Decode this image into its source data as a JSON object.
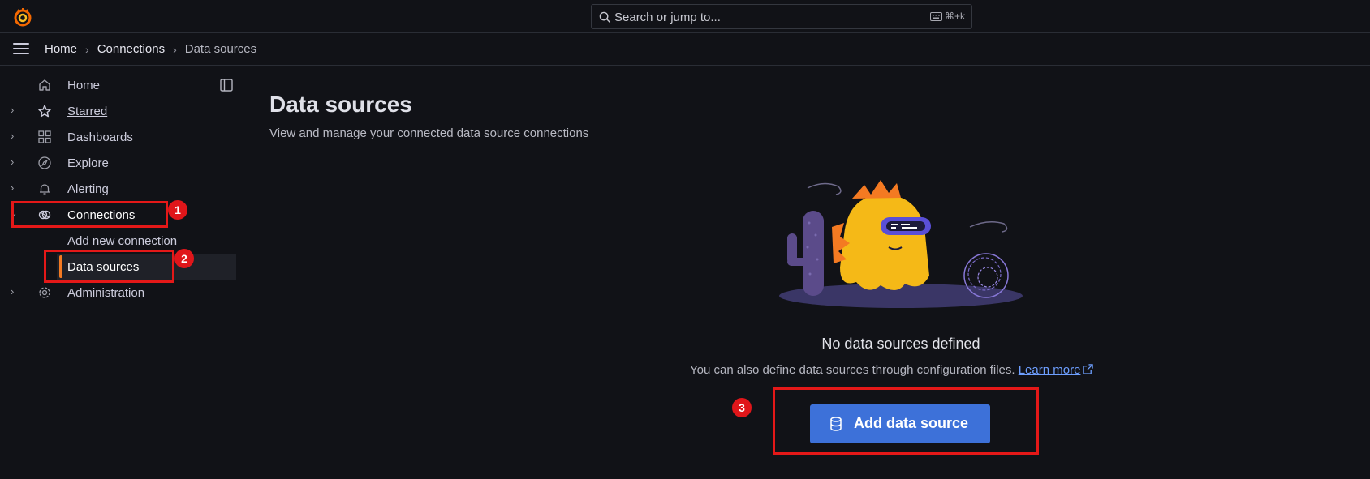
{
  "topbar": {
    "search_placeholder": "Search or jump to...",
    "shortcut": "⌘+k"
  },
  "breadcrumb": [
    "Home",
    "Connections",
    "Data sources"
  ],
  "sidebar": {
    "items": [
      {
        "label": "Home",
        "icon": "home-icon"
      },
      {
        "label": "Starred",
        "icon": "star-icon"
      },
      {
        "label": "Dashboards",
        "icon": "apps-icon"
      },
      {
        "label": "Explore",
        "icon": "compass-icon"
      },
      {
        "label": "Alerting",
        "icon": "bell-icon"
      },
      {
        "label": "Connections",
        "icon": "link-icon"
      },
      {
        "label": "Administration",
        "icon": "cog-icon"
      }
    ],
    "sub_items": [
      {
        "label": "Add new connection"
      },
      {
        "label": "Data sources"
      }
    ]
  },
  "main": {
    "title": "Data sources",
    "subtitle": "View and manage your connected data source connections",
    "empty_title": "No data sources defined",
    "empty_desc": "You can also define data sources through configuration files.",
    "learn_more": "Learn more",
    "add_button": "Add data source"
  },
  "annotations": [
    "1",
    "2",
    "3"
  ],
  "colors": {
    "accent": "#f47a22",
    "primary_button": "#3d71d9",
    "highlight": "#e41818",
    "link": "#6e9fff"
  }
}
